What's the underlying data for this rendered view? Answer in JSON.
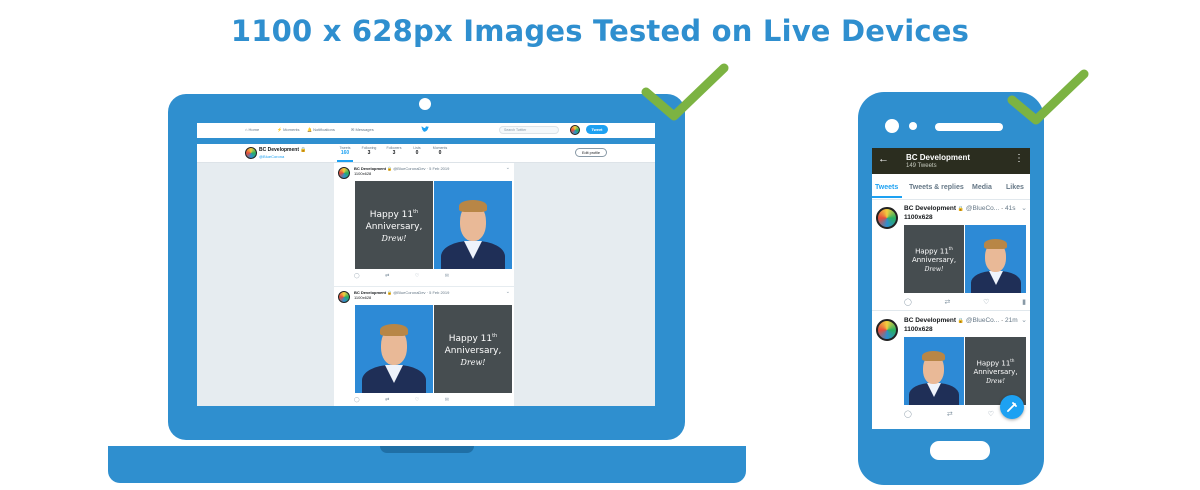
{
  "headline": "1100 x 628px Images Tested on Live Devices",
  "colors": {
    "brand_blue": "#2f8fcf",
    "check_green": "#7cb342",
    "twitter_blue": "#1da1f2",
    "card_dark": "#464d50"
  },
  "laptop": {
    "nav": {
      "home": "Home",
      "moments": "Moments",
      "notifications": "Notifications",
      "messages": "Messages",
      "search_placeholder": "Search Twitter",
      "tweet_button": "Tweet"
    },
    "profile": {
      "name": "BC Development",
      "handle": "@BlueCorona",
      "stats": [
        {
          "label": "Tweets",
          "value": "160"
        },
        {
          "label": "Following",
          "value": "3"
        },
        {
          "label": "Followers",
          "value": "3"
        },
        {
          "label": "Lists",
          "value": "0"
        },
        {
          "label": "Moments",
          "value": "0"
        }
      ],
      "edit_button": "Edit profile"
    },
    "tweets": [
      {
        "name": "BC Development",
        "meta": "@BlueCoronaDev · 5 Feb 2019",
        "text": "1100x628"
      },
      {
        "name": "BC Development",
        "meta": "@BlueCoronaDev · 5 Feb 2019",
        "text": "1100x628"
      }
    ]
  },
  "card": {
    "line1": "Happy 11",
    "sup": "th",
    "line2": "Anniversary,",
    "line3": "Drew!"
  },
  "phone": {
    "header": {
      "title": "BC Development",
      "subtitle": "149 Tweets"
    },
    "tabs": [
      "Tweets",
      "Tweets & replies",
      "Media",
      "Likes"
    ],
    "tweets": [
      {
        "name": "BC Development",
        "handle": "@BlueCo...",
        "time": "41s",
        "text": "1100x628"
      },
      {
        "name": "BC Development",
        "handle": "@BlueCo...",
        "time": "21m",
        "text": "1100x628"
      }
    ]
  },
  "icons": [
    "back-arrow-icon",
    "kebab-menu-icon",
    "reply-icon",
    "retweet-icon",
    "like-icon",
    "analytics-icon",
    "compose-icon",
    "twitter-bird-icon",
    "checkmark-icon"
  ]
}
